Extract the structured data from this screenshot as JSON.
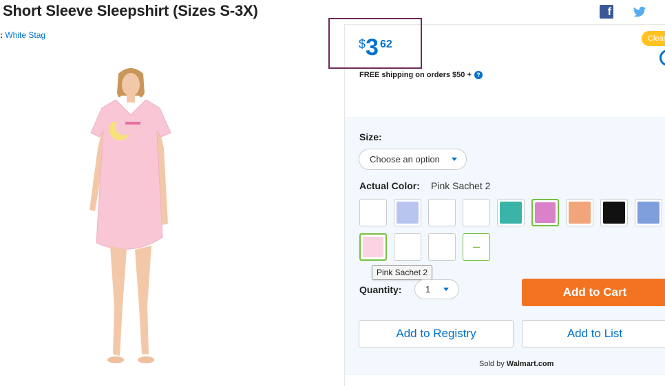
{
  "product": {
    "title": "Short Sleeve Sleepshirt (Sizes S-3X)",
    "brand_prefix": ":",
    "brand": "White Stag",
    "image_icon": "sleepshirt-model-photo"
  },
  "share": {
    "facebook_icon": "facebook-icon",
    "facebook_glyph": "f",
    "twitter_icon": "twitter-icon"
  },
  "price": {
    "currency": "$",
    "whole": "3",
    "cents": "62",
    "shipping": "FREE shipping on orders $50 +",
    "help_glyph": "?"
  },
  "badge": {
    "label": "Clearance"
  },
  "options": {
    "size_label": "Size:",
    "size_value": "Choose an option",
    "color_label": "Actual Color:",
    "color_value": "Pink Sachet 2",
    "swatches": [
      {
        "name": "swatch-1",
        "color": "#ffffff"
      },
      {
        "name": "swatch-2",
        "color": "#b8c6ef"
      },
      {
        "name": "swatch-3",
        "color": "#ffffff"
      },
      {
        "name": "swatch-4",
        "color": "#ffffff"
      },
      {
        "name": "swatch-5",
        "color": "#3ab3a8"
      },
      {
        "name": "swatch-6",
        "color": "#d982c9"
      },
      {
        "name": "swatch-7",
        "color": "#f2a57a"
      },
      {
        "name": "swatch-8",
        "color": "#111111"
      },
      {
        "name": "swatch-9",
        "color": "#7e9fdb"
      },
      {
        "name": "swatch-10",
        "color": "#fbd3e2"
      },
      {
        "name": "swatch-11",
        "color": "#ffffff"
      },
      {
        "name": "swatch-12",
        "color": "#ffffff"
      }
    ],
    "collapse_glyph": "–",
    "tooltip": "Pink Sachet 2"
  },
  "purchase": {
    "quantity_label": "Quantity:",
    "quantity_value": "1",
    "add_to_cart": "Add to Cart",
    "add_to_registry": "Add to Registry",
    "add_to_list": "Add to List",
    "sold_by_prefix": "Sold by",
    "seller": "Walmart.com"
  },
  "colors": {
    "accent_blue": "#0071ce",
    "cart_orange": "#f47321",
    "selected_green": "#76c043",
    "price_box_border": "#6e2b57"
  }
}
